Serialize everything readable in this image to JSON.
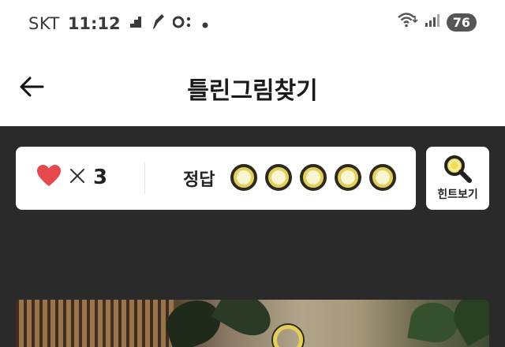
{
  "status_bar": {
    "carrier": "SKT",
    "time": "11:12",
    "battery": "76",
    "icons": [
      "app-notification-icon",
      "pen-notification-icon",
      "link-notification-icon",
      "dot-icon",
      "wifi-icon",
      "signal-icon"
    ]
  },
  "header": {
    "title": "틀린그림찾기",
    "back_icon": "arrow-left-icon"
  },
  "score_card": {
    "lives_icon": "heart-icon",
    "lives_multiplier": "×",
    "lives_count": "3",
    "answer_label": "정답",
    "answers_total": 5,
    "answers_found": 0
  },
  "hint_button": {
    "label": "힌트보기",
    "icon": "magnifier-icon"
  },
  "colors": {
    "heart": "#e5484d",
    "slot_fill": "#fbf6d2",
    "slot_ring": "#e4cf5a",
    "background_dark": "#2a2a2a"
  }
}
